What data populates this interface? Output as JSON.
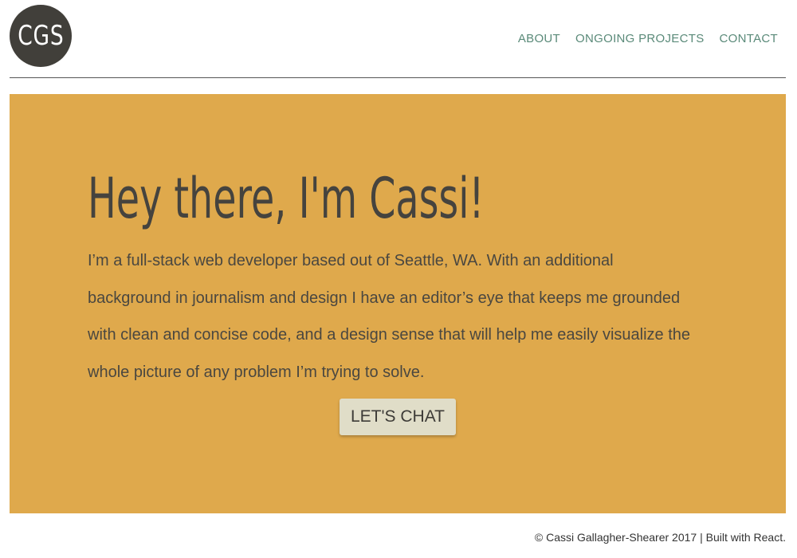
{
  "header": {
    "logo_text": "CGS",
    "nav": [
      {
        "label": "ABOUT"
      },
      {
        "label": "ONGOING PROJECTS"
      },
      {
        "label": "CONTACT"
      }
    ]
  },
  "hero": {
    "title": "Hey there, I'm Cassi!",
    "intro": "I’m a full-stack web developer based out of Seattle, WA. With an additional background in journalism and design I have an editor’s eye that keeps me grounded with clean and concise code, and a design sense that will help me easily visualize the whole picture of any problem I’m trying to solve.",
    "cta_label": "LET'S CHAT"
  },
  "footer": {
    "text": "© Cassi Gallagher-Shearer 2017 | Built with React."
  },
  "colors": {
    "hero_background": "#dfa94c",
    "nav_link": "#5a8a79",
    "logo_background": "#413f3a",
    "button_background": "#e0ddc8"
  }
}
